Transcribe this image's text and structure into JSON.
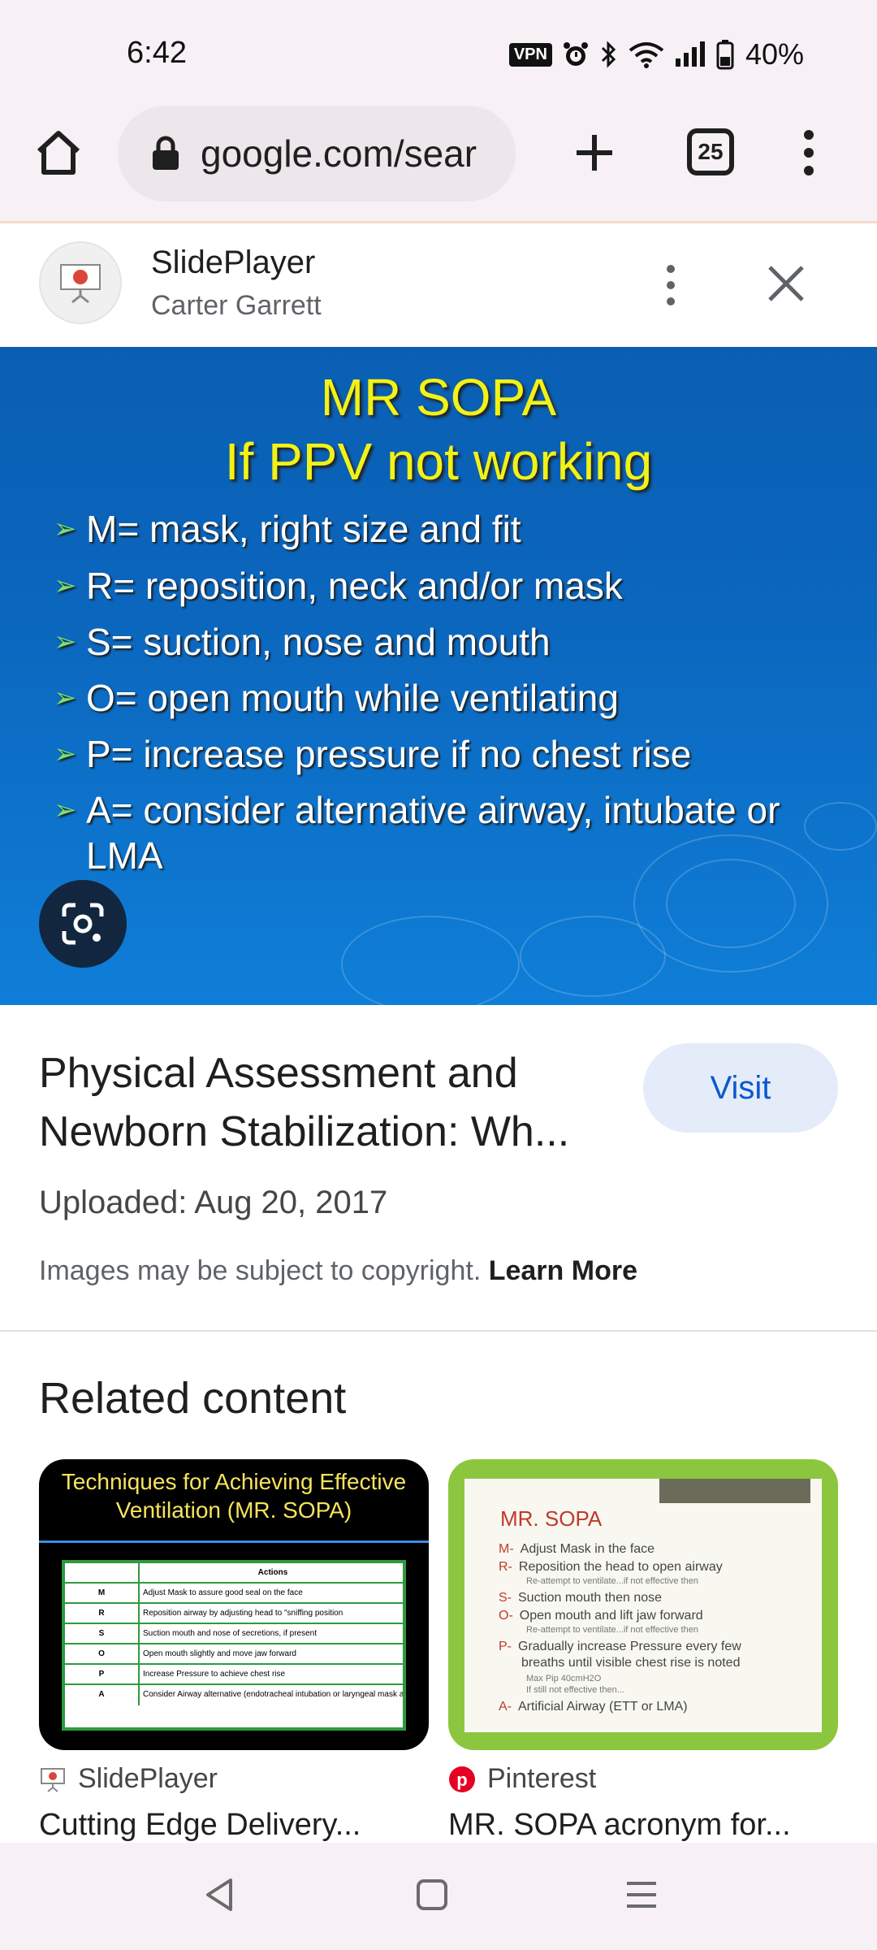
{
  "status_bar": {
    "time": "6:42",
    "vpn": "VPN",
    "battery": "40%",
    "icons": [
      "vpn-badge",
      "alarm-icon",
      "bluetooth-icon",
      "wifi-icon",
      "signal-icon",
      "battery-icon"
    ]
  },
  "browser": {
    "url": "google.com/sear",
    "tab_count": "25",
    "icons": [
      "home-icon",
      "lock-icon",
      "plus-icon",
      "tabs-icon",
      "more-vert-icon"
    ]
  },
  "source": {
    "name": "SlidePlayer",
    "subtitle": "Carter Garrett"
  },
  "slide": {
    "title_line1": "MR SOPA",
    "title_line2": "If PPV not working",
    "bullets": [
      "M= mask, right size and fit",
      "R= reposition, neck and/or mask",
      "S=  suction, nose and mouth",
      "O= open mouth while ventilating",
      "P= increase pressure if no chest rise",
      "A= consider alternative airway, intubate or LMA"
    ],
    "colors": {
      "title": "#f2f216",
      "background": "#0b66bd",
      "bullet_arrow": "#7be06b"
    }
  },
  "result": {
    "title": "Physical Assessment and Newborn Stabilization: Wh...",
    "visit_label": "Visit",
    "uploaded": "Uploaded: Aug 20, 2017",
    "copyright": "Images may be subject to copyright.",
    "learn_more": "Learn More"
  },
  "related": {
    "heading": "Related content",
    "cards": [
      {
        "thumb_title": "Techniques for Achieving Effective Ventilation (MR. SOPA)",
        "table_header": "Actions",
        "rows": [
          {
            "key": "M",
            "text": "Adjust Mask to assure good seal on the face"
          },
          {
            "key": "R",
            "text": "Reposition airway by adjusting head to \"sniffing position"
          },
          {
            "key": "S",
            "text": "Suction mouth and nose of secretions, if present"
          },
          {
            "key": "O",
            "text": "Open mouth slightly and move jaw forward"
          },
          {
            "key": "P",
            "text": "Increase Pressure to achieve chest rise"
          },
          {
            "key": "A",
            "text": "Consider Airway alternative (endotracheal intubation or laryngeal mask airway)"
          }
        ],
        "source": "SlidePlayer",
        "caption": "Cutting Edge Delivery..."
      },
      {
        "thumb_title": "MR. SOPA",
        "lines": [
          {
            "key": "M-",
            "text": "Adjust Mask in the face"
          },
          {
            "key": "R-",
            "text": "Reposition the head to open airway"
          },
          {
            "key": "S-",
            "text": "Suction mouth then nose"
          },
          {
            "key": "O-",
            "text": "Open mouth and lift jaw forward"
          },
          {
            "key": "P-",
            "text": "Gradually increase Pressure every few"
          },
          {
            "key": "",
            "text": "breaths until visible chest rise is noted"
          },
          {
            "key": "A-",
            "text": "Artificial Airway (ETT or LMA)"
          }
        ],
        "sublines": [
          "Re-attempt to ventilate...if not effective then",
          "Re-attempt to ventilate...if not effective then",
          "Max Pip 40cmH2O",
          "If still not effective then..."
        ],
        "source": "Pinterest",
        "caption": "MR. SOPA acronym for..."
      }
    ]
  },
  "nav": {
    "icons": [
      "back-icon",
      "home-square-icon",
      "recents-icon"
    ]
  }
}
